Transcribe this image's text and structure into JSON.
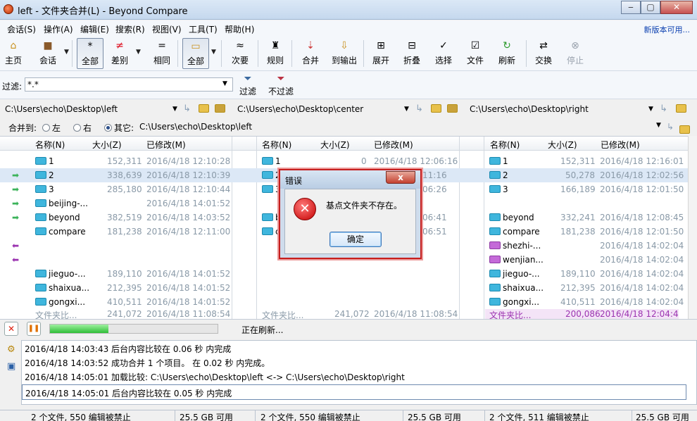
{
  "window": {
    "title": "left - 文件夹合并(L) - Beyond Compare",
    "min": "‒",
    "max": "▢",
    "close": "✕"
  },
  "menu": {
    "items": [
      "会话(S)",
      "操作(A)",
      "编辑(E)",
      "搜索(R)",
      "视图(V)",
      "工具(T)",
      "帮助(H)"
    ],
    "new_version": "新版本可用..."
  },
  "toolbar": {
    "home": "主页",
    "session": "会话",
    "all": "全部",
    "diff": "差别",
    "same": "相同",
    "all2": "全部",
    "minor": "次要",
    "rules": "规则",
    "merge": "合并",
    "to_output": "到输出",
    "expand": "展开",
    "collapse": "折叠",
    "select": "选择",
    "files": "文件",
    "refresh": "刷新",
    "swap": "交换",
    "stop": "停止"
  },
  "filter": {
    "label": "过滤:",
    "value": "*.*",
    "filter_btn": "过滤",
    "no_filter_btn": "不过滤"
  },
  "paths": {
    "left": "C:\\Users\\echo\\Desktop\\left",
    "center": "C:\\Users\\echo\\Desktop\\center",
    "right": "C:\\Users\\echo\\Desktop\\right"
  },
  "merge_to": {
    "label": "合并到:",
    "left": "左",
    "right": "右",
    "other": "其它:",
    "path": "C:\\Users\\echo\\Desktop\\left"
  },
  "columns": {
    "name": "名称(N)",
    "size": "大小(Z)",
    "modified": "已修改(M)"
  },
  "left_rows": [
    {
      "name": "1",
      "size": "152,311",
      "date": "2016/4/18 12:10:28"
    },
    {
      "name": "2",
      "size": "338,639",
      "date": "2016/4/18 12:10:39"
    },
    {
      "name": "3",
      "size": "285,180",
      "date": "2016/4/18 12:10:44"
    },
    {
      "name": "beijing-...",
      "size": "",
      "date": "2016/4/18 14:01:52"
    },
    {
      "name": "beyond",
      "size": "382,519",
      "date": "2016/4/18 14:03:52"
    },
    {
      "name": "compare",
      "size": "181,238",
      "date": "2016/4/18 12:11:00"
    },
    {
      "name": "jieguo-...",
      "size": "189,110",
      "date": "2016/4/18 14:01:52"
    },
    {
      "name": "shaixua...",
      "size": "212,395",
      "date": "2016/4/18 14:01:52"
    },
    {
      "name": "gongxi...",
      "size": "410,511",
      "date": "2016/4/18 14:01:52"
    },
    {
      "name": "文件夹比...",
      "size": "241,072",
      "date": "2016/4/18 11:08:54"
    }
  ],
  "center_rows": [
    {
      "name": "1",
      "size": "0",
      "date": "2016/4/18 12:06:16"
    },
    {
      "name": "2",
      "size": "",
      "date": "11:16"
    },
    {
      "name": "3",
      "size": "",
      "date": "06:26"
    },
    {
      "name": "b",
      "size": "",
      "date": "06:41"
    },
    {
      "name": "c",
      "size": "",
      "date": "06:51"
    },
    {
      "name": "文件夹比...",
      "size": "241,072",
      "date": "2016/4/18 11:08:54"
    }
  ],
  "right_rows": [
    {
      "name": "1",
      "size": "152,311",
      "date": "2016/4/18 12:16:01"
    },
    {
      "name": "2",
      "size": "50,278",
      "date": "2016/4/18 12:02:56"
    },
    {
      "name": "3",
      "size": "166,189",
      "date": "2016/4/18 12:01:50"
    },
    {
      "name": "beyond",
      "size": "332,241",
      "date": "2016/4/18 12:08:45"
    },
    {
      "name": "compare",
      "size": "181,238",
      "date": "2016/4/18 12:01:50"
    },
    {
      "name": "shezhi-...",
      "size": "",
      "date": "2016/4/18 14:02:04"
    },
    {
      "name": "wenjian...",
      "size": "",
      "date": "2016/4/18 14:02:04"
    },
    {
      "name": "jieguo-...",
      "size": "189,110",
      "date": "2016/4/18 14:02:04"
    },
    {
      "name": "shaixua...",
      "size": "212,395",
      "date": "2016/4/18 14:02:04"
    },
    {
      "name": "gongxi...",
      "size": "410,511",
      "date": "2016/4/18 14:02:04"
    },
    {
      "name": "文件夹比...",
      "size": "200,086",
      "date": "2016/4/18 12:04:48"
    }
  ],
  "progress": {
    "status": "正在刷新...",
    "fraction": 0.35
  },
  "log": [
    "2016/4/18 14:03:43  后台内容比较在 0.06 秒 内完成",
    "2016/4/18 14:03:52  成功合并 1 个项目。 在 0.02 秒 内完成。",
    "2016/4/18 14:05:01  加载比较: C:\\Users\\echo\\Desktop\\left <-> C:\\Users\\echo\\Desktop\\right",
    "2016/4/18 14:05:01  后台内容比较在 0.05 秒 内完成"
  ],
  "status": {
    "left": "2 个文件, 550 编辑被禁止",
    "left_free": "25.5 GB 可用",
    "center": "2 个文件, 550 编辑被禁止",
    "center_free": "25.5 GB 可用",
    "right": "2 个文件, 511 编辑被禁止",
    "right_free": "25.5 GB 可用"
  },
  "dialog": {
    "title": "错误",
    "message": "基点文件夹不存在。",
    "ok": "确定",
    "close": "x"
  }
}
